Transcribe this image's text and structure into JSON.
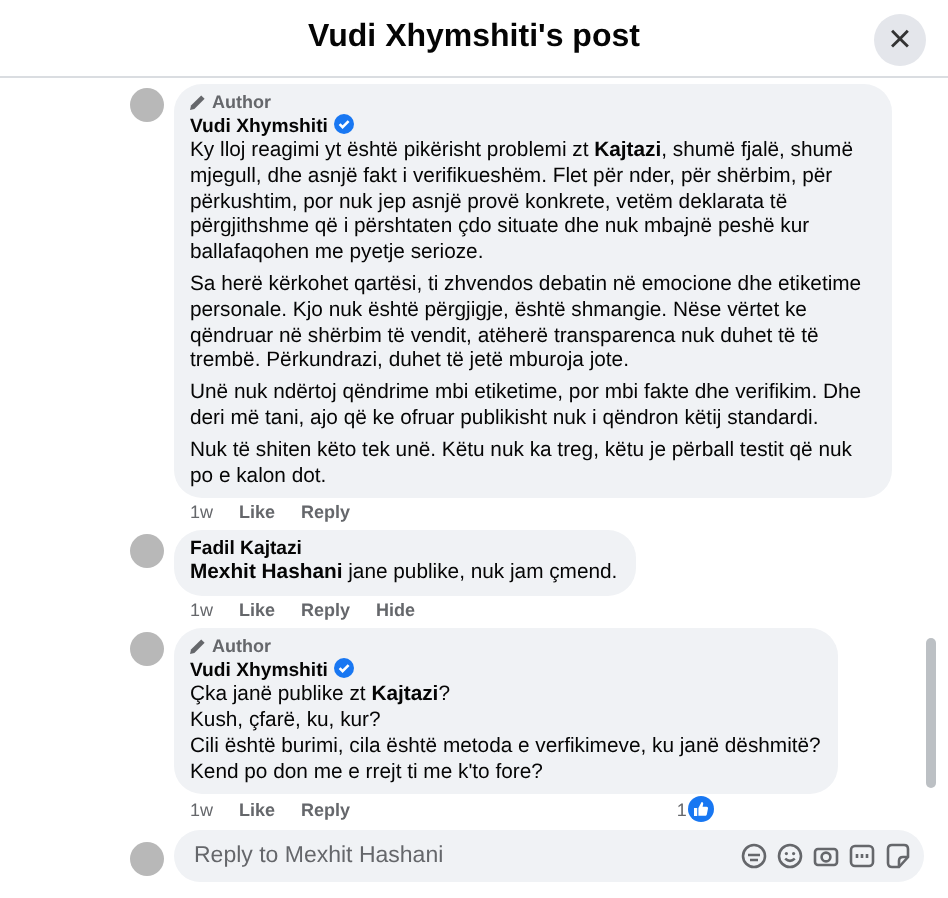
{
  "header": {
    "title": "Vudi Xhymshiti's post",
    "close": "×"
  },
  "comments": [
    {
      "author_badge": "Author",
      "name": "Vudi Xhymshiti",
      "verified": true,
      "paragraphs": [
        "Ky lloj reagimi yt është pikërisht problemi zt **Kajtazi**, shumë fjalë, shumë mjegull, dhe asnjë fakt i verifikueshëm. Flet për nder, për shërbim, për përkushtim, por nuk jep asnjë provë konkrete, vetëm deklarata të përgjithshme që i përshtaten çdo situate dhe nuk mbajnë peshë kur ballafaqohen me pyetje serioze.",
        "Sa herë kërkohet qartësi, ti zhvendos debatin në emocione dhe etiketime personale. Kjo nuk është përgjigje, është shmangie. Nëse vërtet ke qëndruar në shërbim të vendit, atëherë transparenca nuk duhet të të trembë. Përkundrazi, duhet të jetë mburoja jote.",
        "Unë nuk ndërtoj qëndrime mbi etiketime, por mbi fakte dhe verifikim. Dhe deri më tani, ajo që ke ofruar publikisht nuk i qëndron këtij standardi.",
        "Nuk të shiten këto tek unë. Këtu nuk ka treg, këtu je përball testit që nuk po e kalon dot."
      ],
      "time": "1w",
      "actions": [
        "Like",
        "Reply"
      ]
    },
    {
      "name": "Fadil Kajtazi",
      "verified": false,
      "paragraphs": [
        "**Mexhit Hashani** jane publike, nuk jam çmend."
      ],
      "time": "1w",
      "actions": [
        "Like",
        "Reply",
        "Hide"
      ]
    },
    {
      "author_badge": "Author",
      "name": "Vudi Xhymshiti",
      "verified": true,
      "lines": [
        "Çka janë publike zt **Kajtazi**?",
        "Kush, çfarë, ku, kur?",
        "Cili është burimi, cila është metoda e verfikimeve, ku janë dëshmitë?",
        "Kend po don me e rrejt ti me k'to fore?"
      ],
      "time": "1w",
      "actions": [
        "Like",
        "Reply"
      ],
      "like_count": "1"
    }
  ],
  "reply_field": {
    "placeholder": "Reply to Mexhit Hashani"
  }
}
